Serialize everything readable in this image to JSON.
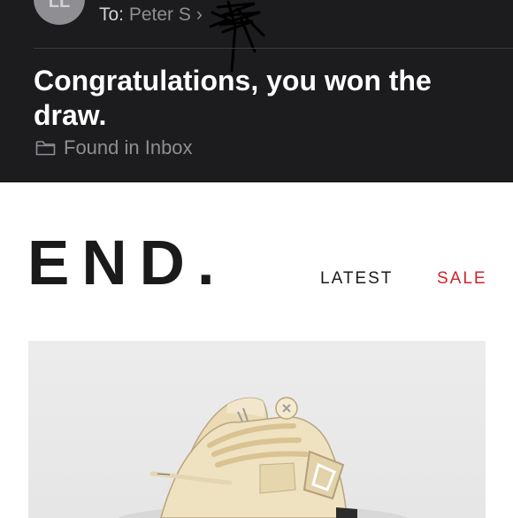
{
  "header": {
    "avatar_initials": "LL",
    "to_prefix": "To:",
    "recipient": "Peter S",
    "subject": "Congratulations, you won the draw.",
    "folder": "Found in Inbox"
  },
  "email": {
    "brand": "END.",
    "nav": [
      {
        "label": "LATEST",
        "color": "#1a1a1a"
      },
      {
        "label": "SALE",
        "color": "#d2232a"
      }
    ]
  },
  "colors": {
    "header_bg": "#1c1c1e",
    "sale_accent": "#d2232a"
  },
  "icons": [
    "folder-icon",
    "chevron-right-icon"
  ],
  "product_image": "sneaker-photo"
}
